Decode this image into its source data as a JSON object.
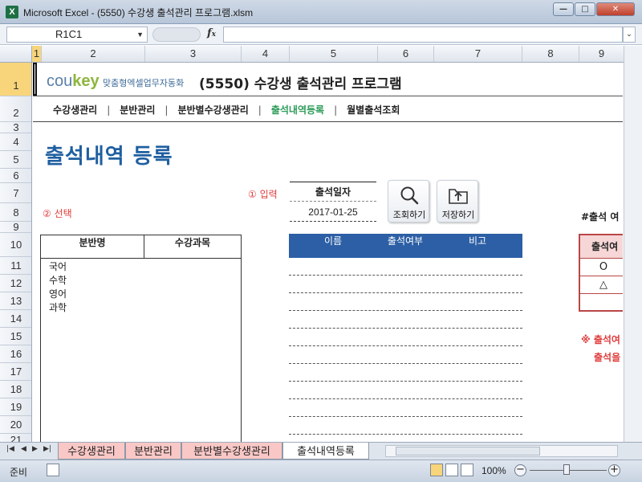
{
  "window": {
    "title": "Microsoft Excel - (5550) 수강생 출석관리 프로그램.xlsm",
    "icon_letter": "X",
    "controls": [
      "minimize-icon",
      "maximize-icon",
      "close-icon"
    ]
  },
  "formula_bar": {
    "name_box": "R1C1",
    "fx": "fx",
    "formula": ""
  },
  "columns": [
    "1",
    "2",
    "3",
    "4",
    "5",
    "6",
    "7",
    "8",
    "9"
  ],
  "rows": [
    "1",
    "2",
    "3",
    "4",
    "5",
    "6",
    "7",
    "8",
    "9",
    "10",
    "11",
    "12",
    "13",
    "14",
    "15",
    "16",
    "17",
    "18",
    "19",
    "20",
    "21"
  ],
  "header": {
    "logo": "coukey",
    "logo_sub": "맞춤형엑셀업무자동화",
    "title": "(5550) 수강생 출석관리 프로그램"
  },
  "nav": {
    "items": [
      "수강생관리",
      "분반관리",
      "분반별수강생관리",
      "출석내역등록",
      "월별출석조회"
    ],
    "active_index": 3
  },
  "section_title": "출석내역 등록",
  "steps": {
    "input": "① 입력",
    "select": "② 선택"
  },
  "date": {
    "label": "출석일자",
    "value": "2017-01-25"
  },
  "buttons": {
    "search": "조회하기",
    "save": "저장하기"
  },
  "class_table": {
    "headers": [
      "분반명",
      "수강과목"
    ],
    "items": [
      "국어",
      "수학",
      "영어",
      "과학"
    ]
  },
  "attendance_table": {
    "headers": [
      "이름",
      "출석여부",
      "비고"
    ]
  },
  "legend": {
    "note": "#출석 여",
    "header": "출석여",
    "symbols": [
      "O",
      "△",
      ""
    ]
  },
  "warning": {
    "line1": "※ 출석여",
    "line2": "출석을"
  },
  "sheet_tabs": [
    "수강생관리",
    "분반관리",
    "분반별수강생관리",
    "출석내역등록"
  ],
  "active_tab_index": 3,
  "status": {
    "ready": "준비",
    "zoom": "100%"
  },
  "colors": {
    "accent_blue": "#1f5fa0",
    "table_header_blue": "#2c5fa5",
    "active_nav_green": "#2e9c5a",
    "warning_red": "#e03c3c",
    "tab_pink": "#f9c8c6"
  }
}
